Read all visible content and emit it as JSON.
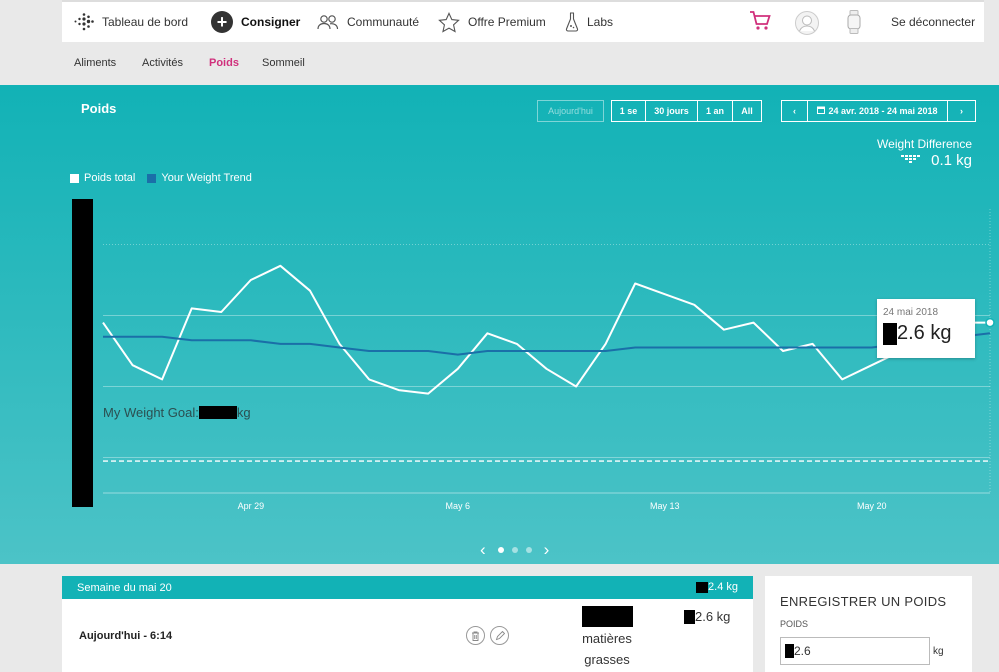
{
  "nav": {
    "items": [
      {
        "label": "Tableau de bord",
        "icon": "fitbit-logo-icon"
      },
      {
        "label": "Consigner",
        "icon": "plus-circle-icon"
      },
      {
        "label": "Communauté",
        "icon": "community-icon"
      },
      {
        "label": "Offre Premium",
        "icon": "star-icon"
      },
      {
        "label": "Labs",
        "icon": "flask-icon"
      }
    ],
    "logout": "Se déconnecter",
    "cart_icon": "cart-icon",
    "avatar_icon": "avatar-icon",
    "watch_icon": "watch-icon"
  },
  "subnav": {
    "tabs": [
      "Aliments",
      "Activités",
      "Poids",
      "Sommeil"
    ],
    "active": "Poids"
  },
  "panel": {
    "title": "Poids",
    "today_btn": "Aujourd'hui",
    "ranges": [
      "1 se",
      "30 jours",
      "1 an",
      "All"
    ],
    "date_range": "24 avr. 2018 - 24 mai 2018",
    "weight_diff_label": "Weight Difference",
    "weight_diff_value": "0.1 kg",
    "legend": [
      "Poids total",
      "Your Weight Trend"
    ],
    "goal_prefix": "My Weight Goal:",
    "goal_unit": "kg",
    "tooltip_date": "24 mai 2018",
    "tooltip_value": "2.6 kg",
    "colors": {
      "teal": "#12b2b6",
      "trend": "#1a6fa8",
      "accent": "#d0307c"
    }
  },
  "chart_data": {
    "type": "line",
    "x": [
      "Apr 24",
      "Apr 25",
      "Apr 26",
      "Apr 27",
      "Apr 28",
      "Apr 29",
      "Apr 30",
      "May 1",
      "May 2",
      "May 3",
      "May 4",
      "May 5",
      "May 6",
      "May 7",
      "May 8",
      "May 9",
      "May 10",
      "May 11",
      "May 12",
      "May 13",
      "May 14",
      "May 15",
      "May 16",
      "May 17",
      "May 18",
      "May 19",
      "May 20",
      "May 21",
      "May 22",
      "May 23",
      "May 24"
    ],
    "xticks": [
      "Apr 29",
      "May 6",
      "May 13",
      "May 20"
    ],
    "series": [
      {
        "name": "Poids total",
        "values": [
          0.9,
          0.3,
          0.1,
          1.1,
          1.05,
          1.5,
          1.7,
          1.35,
          0.6,
          0.1,
          -0.05,
          -0.1,
          0.25,
          0.75,
          0.6,
          0.25,
          0,
          0.6,
          1.45,
          1.3,
          1.15,
          0.8,
          0.9,
          0.5,
          0.6,
          0.1,
          0.3,
          0.5,
          0.75,
          0.9,
          0.9
        ]
      },
      {
        "name": "Your Weight Trend",
        "values": [
          0.7,
          0.7,
          0.7,
          0.65,
          0.65,
          0.65,
          0.6,
          0.6,
          0.55,
          0.5,
          0.5,
          0.5,
          0.45,
          0.5,
          0.5,
          0.5,
          0.5,
          0.5,
          0.55,
          0.55,
          0.55,
          0.55,
          0.55,
          0.55,
          0.55,
          0.55,
          0.55,
          0.6,
          0.65,
          0.7,
          0.75
        ]
      }
    ],
    "ylim": [
      -1.5,
      2.5
    ],
    "goal": -1.05
  },
  "week": {
    "title": "Semaine du mai 20",
    "total": "2.4 kg",
    "row_label": "Aujourd'hui - 6:14",
    "fat_label": "matières grasses",
    "row_value": "2.6 kg",
    "delete_icon": "trash-icon",
    "edit_icon": "pencil-icon"
  },
  "log": {
    "title": "ENREGISTRER UN POIDS",
    "field_label": "POIDS",
    "value": "2.6",
    "unit": "kg"
  }
}
